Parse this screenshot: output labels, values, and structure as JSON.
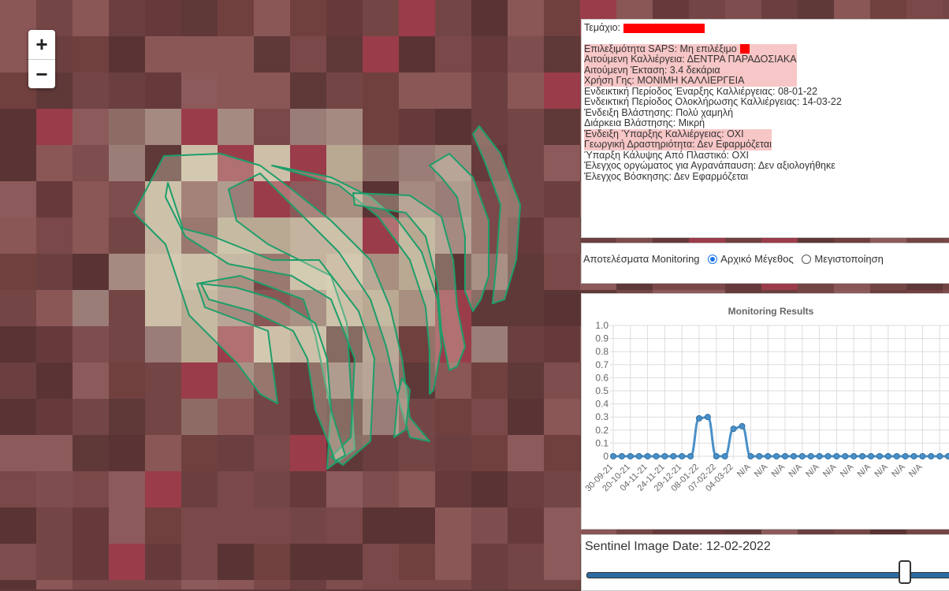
{
  "map": {
    "zoom_in": "+",
    "zoom_out": "−"
  },
  "info": {
    "parcel_label": "Τεμάχιο:",
    "eligibility": "Επιλεξιμότητα SAPS: Μη επιλέξιμο",
    "crop": "Αιτούμενη Καλλιέργεια: ΔΕΝΤΡΑ ΠΑΡΑΔΟΣΙΑΚΑ",
    "area": "Αιτούμενη Έκταση: 3.4 δεκάρια",
    "land_use": "Χρήση Γης: ΜΟΝΙΜΗ ΚΑΛΛΙΕΡΓΕΙΑ",
    "start_period": "Ενδεικτική Περίοδος Έναρξης Καλλιέργειας: 08-01-22",
    "end_period": "Ενδεικτική Περίοδος Ολοκλήρωσης Καλλιέργειας: 14-03-22",
    "vegetation": "Ένδειξη Βλάστησης: Πολύ χαμηλή",
    "vegetation_duration": "Διάρκεια Βλάστησης: Μικρή",
    "cultivation_indication": "Ένδειξη Ύπαρξης Καλλιέργειας: ΟΧΙ",
    "agri_activity": "Γεωργική Δραστηριότητα: Δεν Εφαρμόζεται",
    "plastic_cover": "Ύπαρξη Κάλυψης Από Πλαστικό: ΟΧΙ",
    "plowing_check": "Έλεγχος οργώματος για Αγρανάπαυση: Δεν αξιολογήθηκε",
    "grazing_check": "Έλεγχος Βόσκησης: Δεν Εφαρμόζεται"
  },
  "monitoring": {
    "label": "Αποτελέσματα Monitoring",
    "option_original": "Αρχικό Μέγεθος",
    "option_maximize": "Μεγιστοποίηση"
  },
  "sentinel": {
    "title": "Sentinel Image Date: 12-02-2022",
    "slider_position": 0.86
  },
  "chart_data": {
    "type": "line",
    "title": "Monitoring Results",
    "ylim": [
      0,
      1.0
    ],
    "y_ticks": [
      "1.0",
      "0.9",
      "0.8",
      "0.7",
      "0.6",
      "0.5",
      "0.4",
      "0.3",
      "0.2",
      "0.1",
      "0"
    ],
    "x_tick_labels": [
      "30-09-21",
      "20-10-21",
      "04-11-21",
      "24-11-21",
      "29-12-21",
      "08-01-22",
      "07-02-22",
      "04-03-22",
      "N/A",
      "N/A",
      "N/A",
      "N/A",
      "N/A",
      "N/A",
      "N/A",
      "N/A",
      "N/A",
      "N/A",
      "N/A"
    ],
    "values": [
      0,
      0,
      0,
      0,
      0,
      0,
      0,
      0,
      0,
      0,
      0.29,
      0.3,
      0,
      0,
      0.21,
      0.23,
      0,
      0,
      0,
      0,
      0,
      0,
      0,
      0,
      0,
      0,
      0,
      0,
      0,
      0,
      0,
      0,
      0,
      0,
      0,
      0,
      0,
      0,
      0,
      0,
      0
    ],
    "grid": true,
    "color": "#4a90c8"
  },
  "colors": {
    "highlight": "#f7c6c6",
    "alert": "#ff0000",
    "polygon_stroke": "#1e9e6a",
    "series": "#4a90c8"
  }
}
